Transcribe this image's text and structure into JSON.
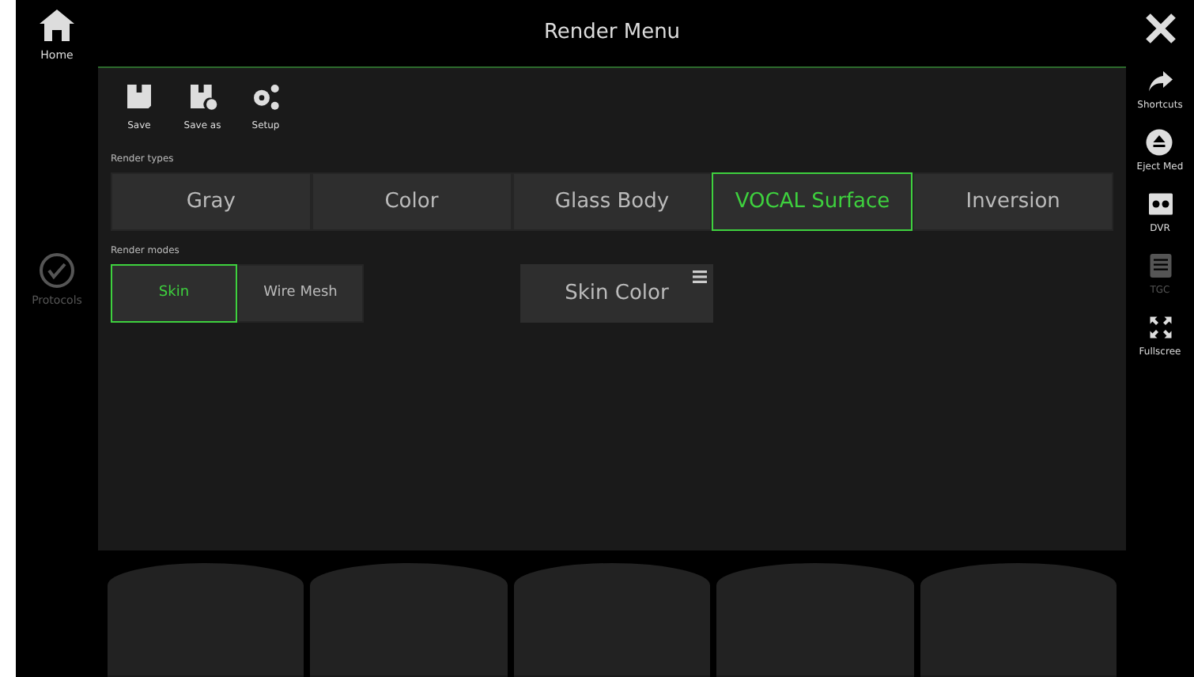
{
  "window": {
    "title": "Render Menu"
  },
  "left_sidebar": [
    {
      "label": "Home",
      "kind": "home",
      "disabled": false
    },
    {
      "label": "Protocols",
      "kind": "check",
      "disabled": true
    }
  ],
  "right_sidebar": [
    {
      "label": "Shortcuts",
      "kind": "share",
      "disabled": false
    },
    {
      "label": "Eject Med",
      "kind": "eject",
      "disabled": false
    },
    {
      "label": "DVR",
      "kind": "dvr",
      "disabled": false
    },
    {
      "label": "TGC",
      "kind": "tgc",
      "disabled": true
    },
    {
      "label": "Fullscree",
      "kind": "fullscreen",
      "disabled": false
    }
  ],
  "toolbar": [
    {
      "label": "Save",
      "kind": "save"
    },
    {
      "label": "Save as",
      "kind": "saveas"
    },
    {
      "label": "Setup",
      "kind": "setup"
    }
  ],
  "render_types": {
    "label": "Render types",
    "items": [
      {
        "label": "Gray",
        "selected": false
      },
      {
        "label": "Color",
        "selected": false
      },
      {
        "label": "Glass Body",
        "selected": false
      },
      {
        "label": "VOCAL Surface",
        "selected": true
      },
      {
        "label": "Inversion",
        "selected": false
      }
    ]
  },
  "render_modes": {
    "label": "Render modes",
    "items": [
      {
        "label": "Skin",
        "selected": true
      },
      {
        "label": "Wire Mesh",
        "selected": false
      }
    ]
  },
  "skin_color": {
    "label": "Skin Color"
  }
}
